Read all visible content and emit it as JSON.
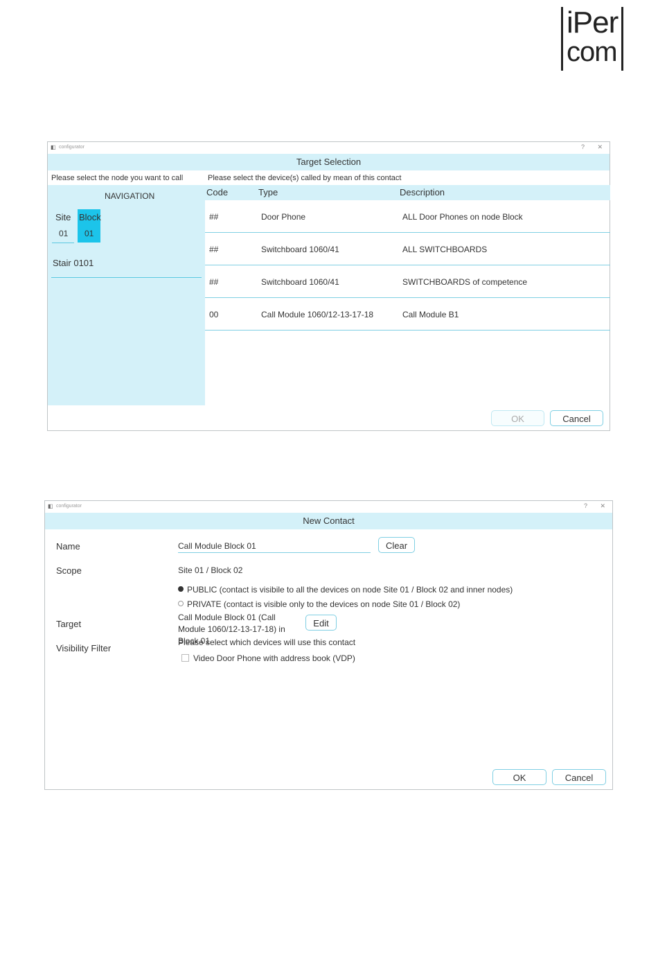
{
  "logo": {
    "line1": "iPer",
    "line2": "com"
  },
  "target_selection": {
    "app_title": "configurator",
    "help": "?",
    "close": "✕",
    "header": "Target Selection",
    "left_label": "Please select the node you want to call",
    "right_label": "Please select the device(s) called by mean of this contact",
    "navigation": {
      "title": "NAVIGATION",
      "site_label": "Site",
      "site_value": "01",
      "block_label": "Block",
      "block_value": "01",
      "stair": "Stair 0101"
    },
    "columns": [
      "Code",
      "Type",
      "Description"
    ],
    "rows": [
      {
        "code": "##",
        "type": "Door Phone",
        "description": "ALL Door Phones on node Block"
      },
      {
        "code": "##",
        "type": "Switchboard 1060/41",
        "description": "ALL SWITCHBOARDS"
      },
      {
        "code": "##",
        "type": "Switchboard 1060/41",
        "description": "SWITCHBOARDS of competence"
      },
      {
        "code": "00",
        "type": "Call Module 1060/12-13-17-18",
        "description": "Call Module B1"
      }
    ],
    "ok_label": "OK",
    "cancel_label": "Cancel"
  },
  "new_contact": {
    "app_title": "configurator",
    "help": "?",
    "close": "✕",
    "header": "New Contact",
    "name_label": "Name",
    "name_value": "Call Module Block 01",
    "clear_label": "Clear",
    "scope_label": "Scope",
    "scope_value": "Site 01 / Block 02",
    "public_option": "PUBLIC  (contact is visibile to all the devices on node Site 01 / Block 02 and inner nodes)",
    "private_option": "PRIVATE (contact is visible only to the devices on node Site 01 / Block 02)",
    "target_label": "Target",
    "target_value": "Call Module Block 01 (Call Module 1060/12-13-17-18) in Block 01",
    "edit_label": "Edit",
    "visibility_label": "Visibility Filter",
    "visibility_hint": "Please select which devices will use this contact",
    "vdp_option": "Video Door Phone with address book (VDP)",
    "ok_label": "OK",
    "cancel_label": "Cancel"
  }
}
